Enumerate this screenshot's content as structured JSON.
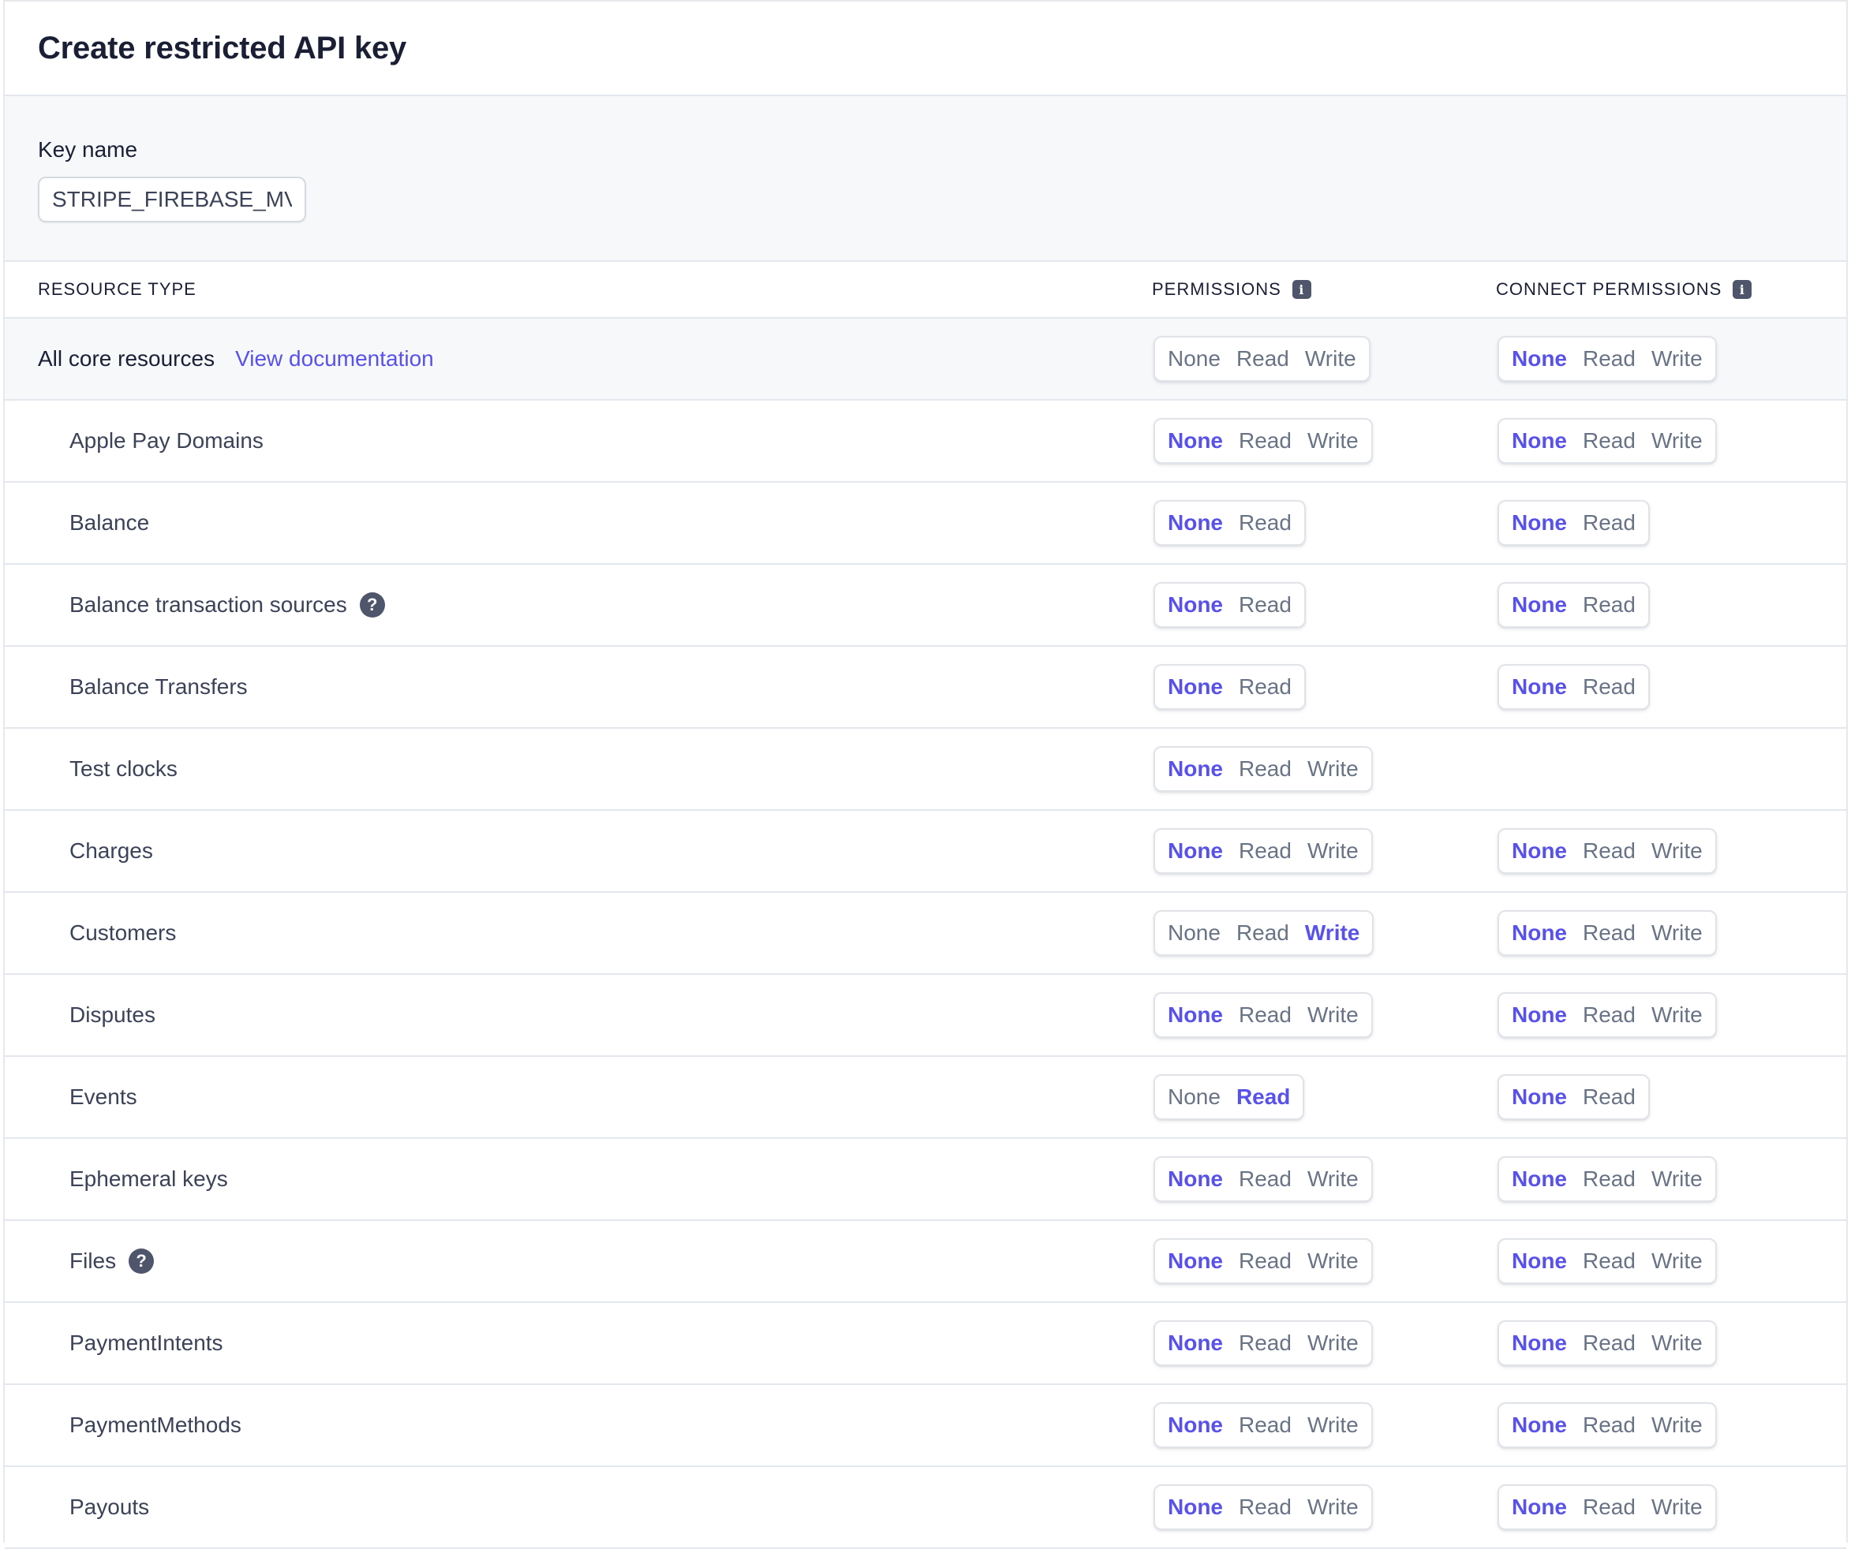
{
  "header": {
    "title": "Create restricted API key"
  },
  "key_name": {
    "label": "Key name",
    "value": "STRIPE_FIREBASE_MVP"
  },
  "table": {
    "col_resource": "RESOURCE TYPE",
    "col_permissions": "PERMISSIONS",
    "col_connect": "CONNECT PERMISSIONS",
    "info_glyph": "i",
    "help_glyph": "?",
    "core": {
      "label": "All core resources",
      "link": "View documentation",
      "permissions": {
        "options": [
          "None",
          "Read",
          "Write"
        ],
        "selected": ""
      },
      "connect": {
        "options": [
          "None",
          "Read",
          "Write"
        ],
        "selected": "None"
      }
    },
    "rows": [
      {
        "name": "Apple Pay Domains",
        "help": false,
        "permissions": {
          "options": [
            "None",
            "Read",
            "Write"
          ],
          "selected": "None"
        },
        "connect": {
          "options": [
            "None",
            "Read",
            "Write"
          ],
          "selected": "None"
        }
      },
      {
        "name": "Balance",
        "help": false,
        "permissions": {
          "options": [
            "None",
            "Read"
          ],
          "selected": "None"
        },
        "connect": {
          "options": [
            "None",
            "Read"
          ],
          "selected": "None"
        }
      },
      {
        "name": "Balance transaction sources",
        "help": true,
        "permissions": {
          "options": [
            "None",
            "Read"
          ],
          "selected": "None"
        },
        "connect": {
          "options": [
            "None",
            "Read"
          ],
          "selected": "None"
        }
      },
      {
        "name": "Balance Transfers",
        "help": false,
        "permissions": {
          "options": [
            "None",
            "Read"
          ],
          "selected": "None"
        },
        "connect": {
          "options": [
            "None",
            "Read"
          ],
          "selected": "None"
        }
      },
      {
        "name": "Test clocks",
        "help": false,
        "permissions": {
          "options": [
            "None",
            "Read",
            "Write"
          ],
          "selected": "None"
        },
        "connect": null
      },
      {
        "name": "Charges",
        "help": false,
        "permissions": {
          "options": [
            "None",
            "Read",
            "Write"
          ],
          "selected": "None"
        },
        "connect": {
          "options": [
            "None",
            "Read",
            "Write"
          ],
          "selected": "None"
        }
      },
      {
        "name": "Customers",
        "help": false,
        "permissions": {
          "options": [
            "None",
            "Read",
            "Write"
          ],
          "selected": "Write"
        },
        "connect": {
          "options": [
            "None",
            "Read",
            "Write"
          ],
          "selected": "None"
        }
      },
      {
        "name": "Disputes",
        "help": false,
        "permissions": {
          "options": [
            "None",
            "Read",
            "Write"
          ],
          "selected": "None"
        },
        "connect": {
          "options": [
            "None",
            "Read",
            "Write"
          ],
          "selected": "None"
        }
      },
      {
        "name": "Events",
        "help": false,
        "permissions": {
          "options": [
            "None",
            "Read"
          ],
          "selected": "Read"
        },
        "connect": {
          "options": [
            "None",
            "Read"
          ],
          "selected": "None"
        }
      },
      {
        "name": "Ephemeral keys",
        "help": false,
        "permissions": {
          "options": [
            "None",
            "Read",
            "Write"
          ],
          "selected": "None"
        },
        "connect": {
          "options": [
            "None",
            "Read",
            "Write"
          ],
          "selected": "None"
        }
      },
      {
        "name": "Files",
        "help": true,
        "permissions": {
          "options": [
            "None",
            "Read",
            "Write"
          ],
          "selected": "None"
        },
        "connect": {
          "options": [
            "None",
            "Read",
            "Write"
          ],
          "selected": "None"
        }
      },
      {
        "name": "PaymentIntents",
        "help": false,
        "permissions": {
          "options": [
            "None",
            "Read",
            "Write"
          ],
          "selected": "None"
        },
        "connect": {
          "options": [
            "None",
            "Read",
            "Write"
          ],
          "selected": "None"
        }
      },
      {
        "name": "PaymentMethods",
        "help": false,
        "permissions": {
          "options": [
            "None",
            "Read",
            "Write"
          ],
          "selected": "None"
        },
        "connect": {
          "options": [
            "None",
            "Read",
            "Write"
          ],
          "selected": "None"
        }
      },
      {
        "name": "Payouts",
        "help": false,
        "permissions": {
          "options": [
            "None",
            "Read",
            "Write"
          ],
          "selected": "None"
        },
        "connect": {
          "options": [
            "None",
            "Read",
            "Write"
          ],
          "selected": "None"
        }
      }
    ]
  },
  "colors": {
    "accent": "#5851ea",
    "text": "#1a1f36",
    "muted": "#697386",
    "band": "#f6f8fa"
  }
}
